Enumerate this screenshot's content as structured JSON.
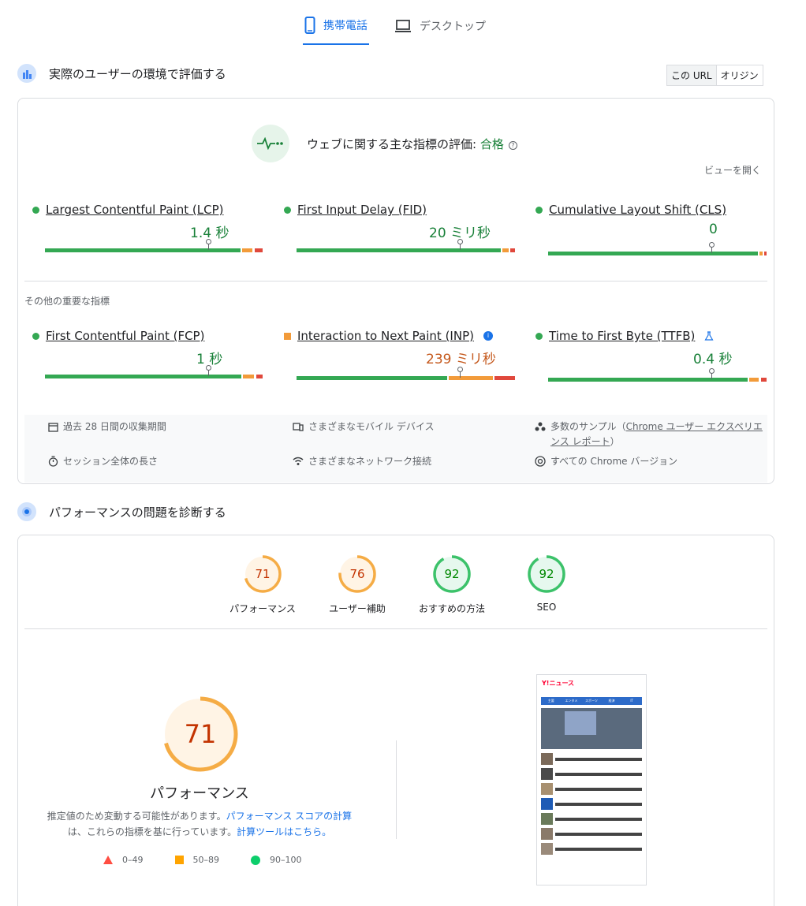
{
  "tabs": [
    {
      "label": "携帯電話",
      "icon": "mobile-icon",
      "active": true
    },
    {
      "label": "デスクトップ",
      "icon": "laptop-icon",
      "active": false
    }
  ],
  "field": {
    "title": "実際のユーザーの環境で評価する",
    "toggle": [
      "この URL",
      "オリジン"
    ],
    "assessment_prefix": "ウェブに関する主な指標の評価: ",
    "assessment_result": "合格",
    "expand_label": "ビューを開く",
    "core_metrics": [
      {
        "name": "Largest Contentful Paint (LCP)",
        "value": "1.4 秒",
        "status": "good",
        "marker_pct": 75
      },
      {
        "name": "First Input Delay (FID)",
        "value": "20 ミリ秒",
        "status": "good",
        "marker_pct": 75
      },
      {
        "name": "Cumulative Layout Shift (CLS)",
        "value": "0",
        "status": "good",
        "marker_pct": 75
      }
    ],
    "other_label": "その他の重要な指標",
    "other_metrics": [
      {
        "name": "First Contentful Paint (FCP)",
        "value": "1 秒",
        "status": "good",
        "marker_pct": 75
      },
      {
        "name": "Interaction to Next Paint (INP)",
        "value": "239 ミリ秒",
        "status": "needs-improvement",
        "marker_pct": 75
      },
      {
        "name": "Time to First Byte (TTFB)",
        "value": "0.4 秒",
        "status": "good",
        "marker_pct": 75
      }
    ],
    "info": {
      "period": "過去 28 日間の収集期間",
      "devices": "さまざまなモバイル デバイス",
      "samples_prefix": "多数のサンプル（",
      "samples_link": "Chrome ユーザー エクスペリエンス レポート",
      "samples_suffix": "）",
      "session": "セッション全体の長さ",
      "network": "さまざまなネットワーク接続",
      "chrome": "すべての Chrome バージョン"
    }
  },
  "lab": {
    "title": "パフォーマンスの問題を診断する",
    "scores": [
      {
        "label": "パフォーマンス",
        "score": 71,
        "color": "#e8710a"
      },
      {
        "label": "ユーザー補助",
        "score": 76,
        "color": "#e8710a"
      },
      {
        "label": "おすすめの方法",
        "score": 92,
        "color": "#0d904f"
      },
      {
        "label": "SEO",
        "score": 92,
        "color": "#0d904f"
      }
    ],
    "main_score": 71,
    "main_label": "パフォーマンス",
    "note_1": "推定値のため変動する可能性があります。",
    "note_link_1": "パフォーマンス スコアの計算",
    "note_2": "は、これらの指標を基に行っています。",
    "note_link_2": "計算ツールはこちら。",
    "legend": [
      "0–49",
      "50–89",
      "90–100"
    ],
    "screenshot": {
      "logo": "Y!ニュース",
      "nav": [
        "主要",
        "エンタメ",
        "スポーツ",
        "経済",
        "IT"
      ]
    }
  },
  "colors": {
    "good": "#0cce6b",
    "average": "#ffa400",
    "poor": "#ff4e42",
    "accent": "#1a73e8"
  }
}
